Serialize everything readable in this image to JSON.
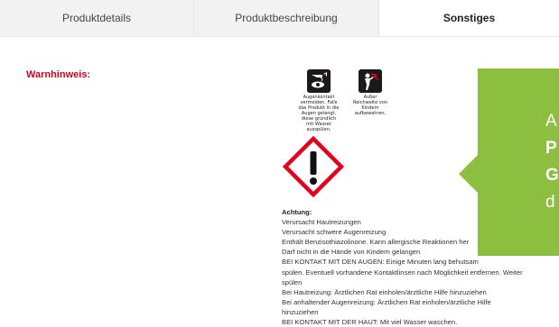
{
  "tabs": [
    {
      "label": "Produktdetails",
      "active": false
    },
    {
      "label": "Produktbeschreibung",
      "active": false
    },
    {
      "label": "Sonstiges",
      "active": true
    }
  ],
  "warning": {
    "label": "Warnhinweis:",
    "pictogram_1": {
      "icon": "eye-wash-icon",
      "caption": "Augenkontakt vermeiden. Falls das Produkt in die Augen gelangt, diese gründlich mit Wasser ausspülen."
    },
    "pictogram_2": {
      "icon": "keep-away-from-children-icon",
      "caption": "Außer Reichweite von Kindern aufbewahren."
    },
    "ghs_icon": "ghs07-exclamation-icon",
    "lines": [
      "Achtung:",
      "Verursacht Hautreizungen",
      "Verursacht schwere Augenreizung",
      "Enthält Benzisothiazolinone. Kann allergische Reaktionen her",
      "Darf nicht in die Hände von Kindern gelangen",
      "BEI KONTAKT MIT DEN AUGEN: Einige Minuten lang behutsam",
      "spülen. Eventuell vorhandene Kontaktlinsen nach Möglichkeit entfernen. Weiter",
      "spülen",
      "Bei Hautreizung: Ärztlichen Rat einholen/ärztliche Hilfe hinzuziehen",
      "Bei anhaltender Augenreizung: Ärztlichen Rat einholen/ärztliche Hilfe",
      "hinzuziehen",
      "BEI KONTAKT MIT DER HAUT: Mit viel Wasser waschen."
    ]
  },
  "popup": {
    "color": "#8cbf3f",
    "lines": [
      "A",
      "P",
      "G",
      "d"
    ]
  },
  "colors": {
    "warning_red": "#d0021b",
    "ghs_red": "#e2001a"
  }
}
